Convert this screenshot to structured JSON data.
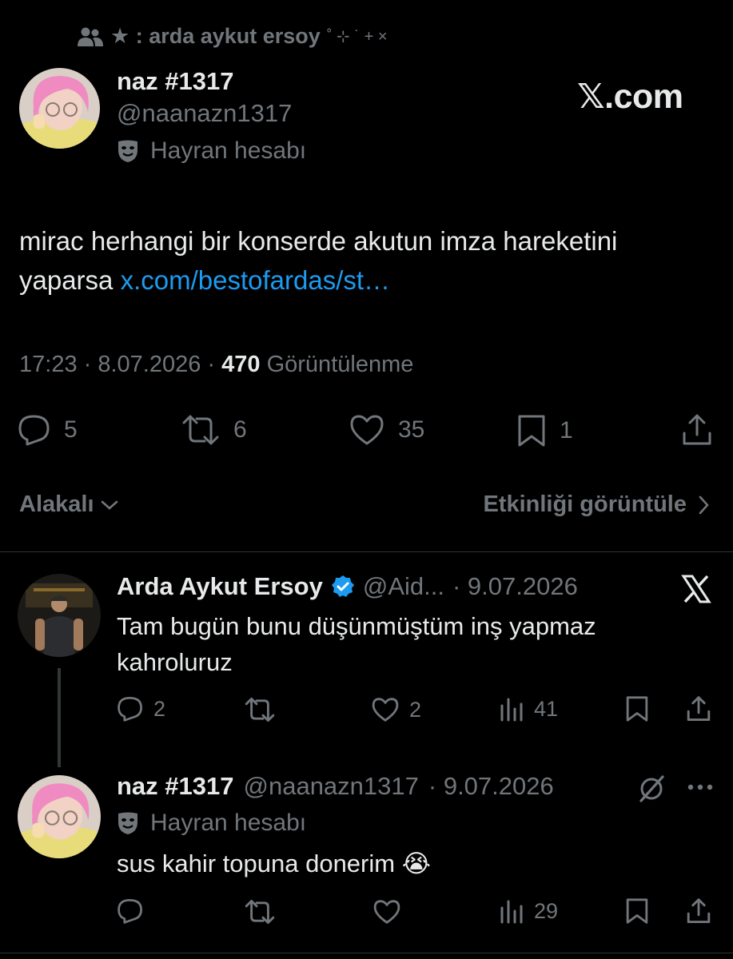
{
  "community": {
    "label": "★ : arda aykut ersoy",
    "suffix": "˚ ⊹ ˙ + ×"
  },
  "main_tweet": {
    "name": "naz #1317",
    "handle": "@naanazn1317",
    "account_label": "Hayran hesabı",
    "watermark": "𝕏.com",
    "text": "mirac herhangi bir konserde akutun imza hareketini yaparsa ",
    "link": "x.com/bestofardas/st…",
    "time": "17:23 · 8.07.2026 · ",
    "views_count": "470",
    "views_label": " Görüntülenme",
    "actions": {
      "replies": "5",
      "reposts": "6",
      "likes": "35",
      "bookmarks": "1"
    }
  },
  "sort": {
    "label": "Alakalı",
    "activity_label": "Etkinliği görüntüle"
  },
  "replies": [
    {
      "name": "Arda Aykut Ersoy",
      "handle": "@Aid...",
      "date": "· 9.07.2026",
      "text": "Tam bugün bunu düşünmüştüm inş yapmaz kahroluruz",
      "actions": {
        "replies": "2",
        "reposts": "",
        "likes": "2",
        "views": "41"
      }
    },
    {
      "name": "naz #1317",
      "handle": "@naanazn1317",
      "date": "· 9.07.2026",
      "account_label": "Hayran hesabı",
      "text": "sus kahir topuna donerim",
      "emoji": "😭",
      "actions": {
        "replies": "",
        "reposts": "",
        "likes": "",
        "views": "29"
      }
    }
  ],
  "colors": {
    "background": "#000000",
    "text": "#e7e9ea",
    "muted": "#71767b",
    "link": "#1d9bf0",
    "verified": "#1d9bf0",
    "divider": "#2f3336"
  }
}
